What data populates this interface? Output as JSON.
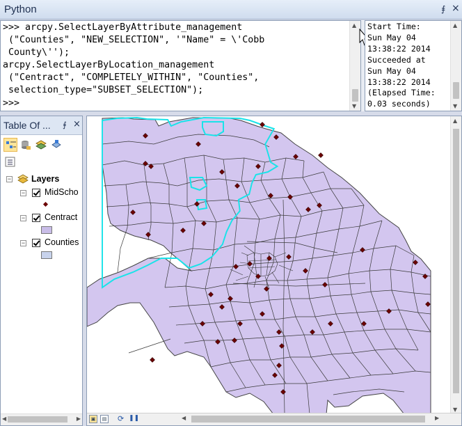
{
  "window": {
    "title": "Python",
    "pin": "⨎",
    "close": "×"
  },
  "python_input": {
    "text": ">>> arcpy.SelectLayerByAttribute_management\n (\"Counties\", \"NEW_SELECTION\", '\"Name\" = \\'Cobb\n County\\'');\narcpy.SelectLayerByLocation_management\n (\"Centract\", \"COMPLETELY_WITHIN\", \"Counties\",\n selection_type=\"SUBSET_SELECTION\");\n>>>"
  },
  "python_output": {
    "text": "Start Time:\nSun May 04\n13:38:22 2014\nSucceeded at\nSun May 04\n13:38:22 2014\n(Elapsed Time:\n0.03 seconds)"
  },
  "toc": {
    "title": "Table Of ...",
    "pin": "⨎",
    "close": "×",
    "toolbar": [
      "list-by-drawing-order-icon",
      "list-by-source-icon",
      "list-by-visibility-icon",
      "list-by-selection-icon",
      "options-icon"
    ],
    "group": {
      "label": "Layers"
    },
    "layers": [
      {
        "name": "MidScho",
        "checked": true,
        "symbol": "point",
        "color": "#6b0000"
      },
      {
        "name": "Centract",
        "checked": true,
        "symbol": "polygon",
        "color": "#c9bde8"
      },
      {
        "name": "Counties",
        "checked": true,
        "symbol": "polygon",
        "color": "#c8d3ec"
      }
    ]
  },
  "map": {
    "fill_color": "#d3c6ef",
    "line_color": "#3a3a3a",
    "selection_color": "#19e3e9",
    "point_color": "#6b0000"
  }
}
